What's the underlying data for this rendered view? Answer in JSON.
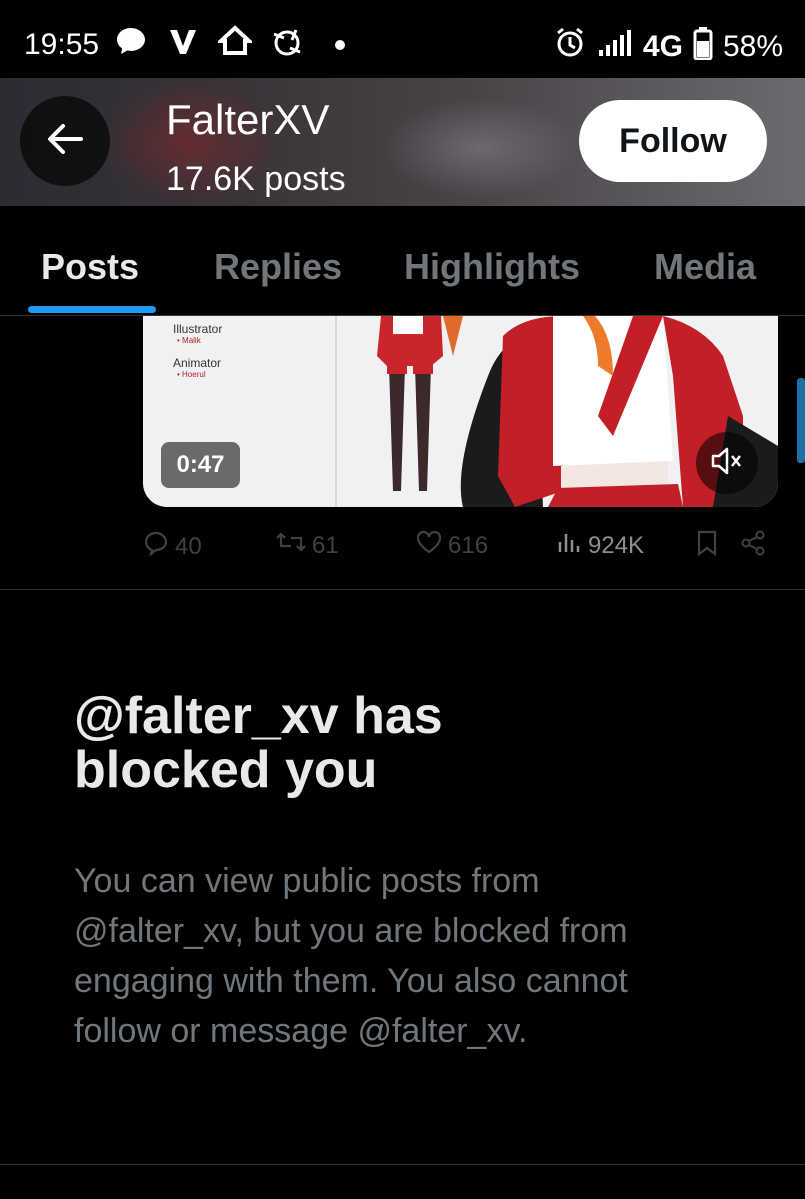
{
  "status_bar": {
    "time": "19:55",
    "network": "4G",
    "battery": "58%",
    "icons": [
      "chat-bubble-icon",
      "v-app-icon",
      "home-icon",
      "sync-icon",
      "dot-icon",
      "alarm-icon",
      "signal-icon",
      "battery-icon"
    ]
  },
  "header": {
    "name": "FalterXV",
    "posts_count": "17.6K posts",
    "follow_label": "Follow"
  },
  "tabs": [
    {
      "label": "Posts",
      "active": true
    },
    {
      "label": "Replies",
      "active": false
    },
    {
      "label": "Highlights",
      "active": false
    },
    {
      "label": "Media",
      "active": false
    }
  ],
  "media": {
    "credits": [
      {
        "role": "Illustrator",
        "name": "Malik"
      },
      {
        "role": "Animator",
        "name": "Hoerul"
      }
    ],
    "duration": "0:47"
  },
  "post_actions": {
    "replies": "40",
    "reposts": "61",
    "likes": "616",
    "views": "924K"
  },
  "blocked": {
    "title_line1": "@falter_xv has",
    "title_line2": "blocked you",
    "body_lines": [
      "You can view public posts from",
      "@falter_xv, but you are blocked from",
      "engaging with them. You also cannot",
      "follow or message @falter_xv."
    ]
  },
  "colors": {
    "background": "#000000",
    "accent": "#1d9bf0",
    "muted_text": "#71767b",
    "primary_text": "#e7e9ea"
  }
}
